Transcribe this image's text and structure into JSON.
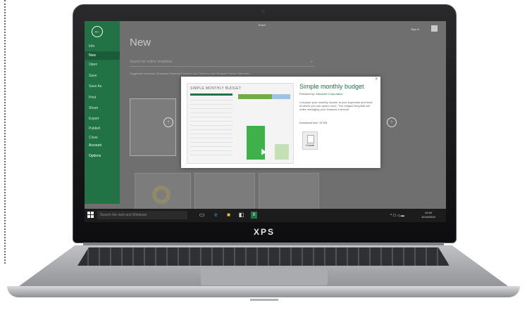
{
  "device": {
    "brand": "XPS"
  },
  "excel": {
    "app_title": "Excel",
    "user_name": "Sign in",
    "nav": [
      {
        "label": "Info"
      },
      {
        "label": "New"
      },
      {
        "label": "Open"
      },
      {
        "label": "Save"
      },
      {
        "label": "Save As"
      },
      {
        "label": "Print"
      },
      {
        "label": "Share"
      },
      {
        "label": "Export"
      },
      {
        "label": "Publish"
      },
      {
        "label": "Close"
      },
      {
        "label": "Account"
      },
      {
        "label": "Options"
      }
    ],
    "heading": "New",
    "search_placeholder": "Search for online templates",
    "suggested": "Suggested searches:  Business   Personal   Planners and Trackers   Lists   Budgets   Charts   Calendars"
  },
  "dialog": {
    "preview_title": "SIMPLE MONTHLY BUDGET",
    "title": "Simple monthly budget",
    "provider_label": "Provided by:",
    "provider": "Microsoft Corporation",
    "description": "Compare your monthly income to your expenses and track of where you can spend more. This elegant template will make managing your finances a breeze.",
    "download_size_label": "Download size:",
    "download_size": "32 KB",
    "create_label": "Create",
    "close_label": "×"
  },
  "taskbar": {
    "search_placeholder": "Search the web and Windows",
    "tray": "^ ☐ ◁ ▬",
    "clock_time": "10:45",
    "clock_date": "11/16/2015"
  },
  "icons": {
    "back": "back-arrow-icon",
    "prev": "chevron-left-icon",
    "next": "chevron-right-icon",
    "start": "windows-logo-icon",
    "task_view": "task-view-icon",
    "edge": "edge-icon",
    "explorer": "folder-icon",
    "store": "store-icon",
    "excel": "excel-icon"
  },
  "colors": {
    "excel_green": "#217346",
    "taskbar": "#1c1c1c"
  }
}
